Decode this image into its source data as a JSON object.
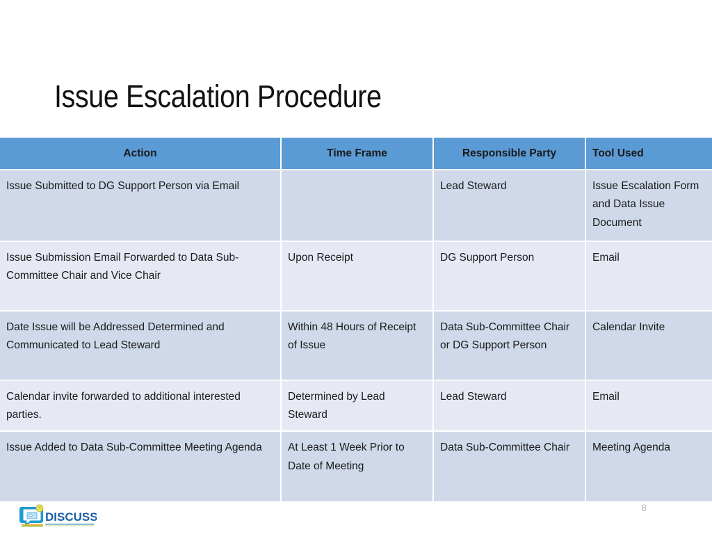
{
  "slide": {
    "title": "Issue Escalation Procedure",
    "page_number": "8",
    "logo_text": "DISCUSS"
  },
  "colors": {
    "header_blue": "#5b9bd5",
    "row_dark": "#cfd9ea",
    "row_light": "#e6e9f4",
    "title_text": "#111111",
    "logo_blue": "#1a5fa8",
    "page_number_gray": "#b9b9b9"
  },
  "table": {
    "columns": [
      {
        "label": "Action",
        "align": "center"
      },
      {
        "label": "Time Frame",
        "align": "center"
      },
      {
        "label": "Responsible Party",
        "align": "center"
      },
      {
        "label": "Tool Used",
        "align": "left"
      }
    ],
    "rows": [
      {
        "action": "Issue Submitted to DG Support Person via Email",
        "time_frame": "",
        "responsible_party": "Lead Steward",
        "tool_used": "Issue Escalation Form and Data Issue Document"
      },
      {
        "action": "Issue Submission Email Forwarded to Data Sub-Committee Chair and Vice Chair",
        "time_frame": "Upon Receipt",
        "responsible_party": "DG Support Person",
        "tool_used": "Email"
      },
      {
        "action": "Date Issue will be Addressed Determined and Communicated to Lead Steward",
        "time_frame": "Within 48 Hours of Receipt of Issue",
        "responsible_party": "Data Sub-Committee Chair or DG Support Person",
        "tool_used": "Calendar Invite"
      },
      {
        "action": "Calendar invite forwarded to additional interested parties.",
        "time_frame": "Determined by Lead Steward",
        "responsible_party": "Lead Steward",
        "tool_used": "Email"
      },
      {
        "action": "Issue Added to Data Sub-Committee Meeting Agenda",
        "time_frame": "At Least 1 Week Prior to Date of Meeting",
        "responsible_party": "Data Sub-Committee Chair",
        "tool_used": "Meeting Agenda"
      }
    ]
  }
}
